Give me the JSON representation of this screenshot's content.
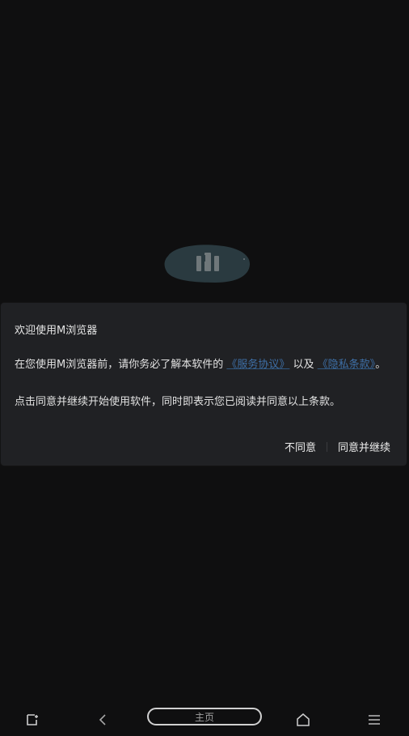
{
  "dialog": {
    "title": "欢迎使用M浏览器",
    "paragraph1_prefix": "在您使用M浏览器前，请你务必了解本软件的",
    "link_service": "《服务协议》",
    "paragraph1_middle": "以及",
    "link_privacy": "《隐私条款》",
    "paragraph1_suffix": "。",
    "paragraph2": "点击同意并继续开始使用软件，同时即表示您已阅读并同意以上条款。",
    "disagree_label": "不同意",
    "agree_label": "同意并继续"
  },
  "bottom_nav": {
    "home_pill_label": "主页",
    "icons": [
      "tabs-icon",
      "back-icon",
      "home-icon",
      "menu-icon"
    ]
  },
  "colors": {
    "background": "#0f0f10",
    "dialog_bg": "#202124",
    "link": "#3e6fa6",
    "logo_bg": "#2a3a40"
  }
}
